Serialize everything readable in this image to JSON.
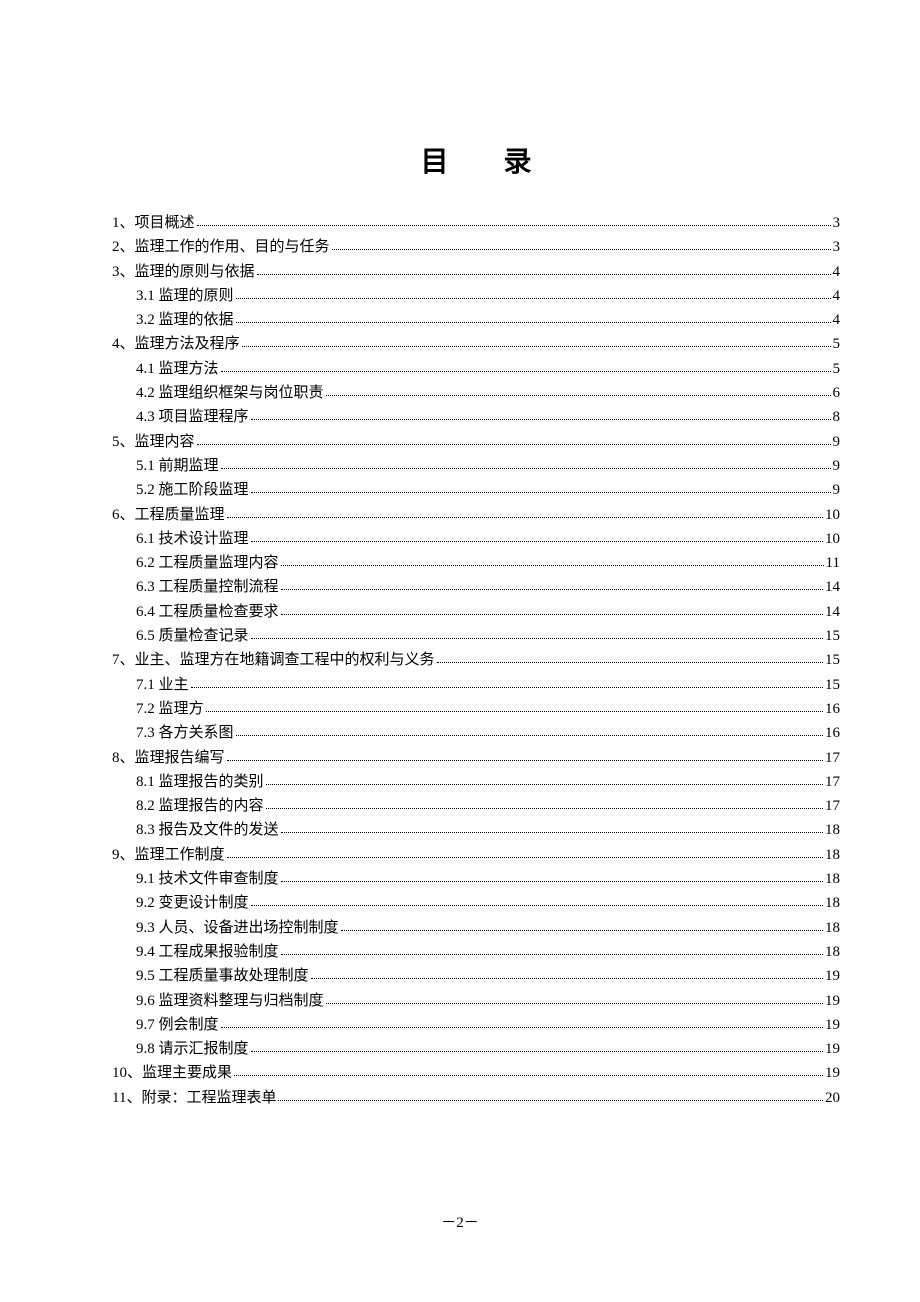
{
  "title": "目 录",
  "page_number": "－2－",
  "toc": [
    {
      "level": 1,
      "label": "1、项目概述",
      "page": "3"
    },
    {
      "level": 1,
      "label": "2、监理工作的作用、目的与任务",
      "page": "3"
    },
    {
      "level": 1,
      "label": "3、监理的原则与依据",
      "page": "4"
    },
    {
      "level": 2,
      "label": "3.1 监理的原则 ",
      "page": "4"
    },
    {
      "level": 2,
      "label": "3.2 监理的依据 ",
      "page": "4"
    },
    {
      "level": 1,
      "label": "4、监理方法及程序",
      "page": "5"
    },
    {
      "level": 2,
      "label": "4.1 监理方法 ",
      "page": "5"
    },
    {
      "level": 2,
      "label": "4.2 监理组织框架与岗位职责 ",
      "page": "6"
    },
    {
      "level": 2,
      "label": "4.3 项目监理程序 ",
      "page": "8"
    },
    {
      "level": 1,
      "label": "5、监理内容",
      "page": "9"
    },
    {
      "level": 2,
      "label": "5.1 前期监理 ",
      "page": "9"
    },
    {
      "level": 2,
      "label": "5.2 施工阶段监理 ",
      "page": "9"
    },
    {
      "level": 1,
      "label": "6、工程质量监理",
      "page": "10"
    },
    {
      "level": 2,
      "label": "6.1  技术设计监理 ",
      "page": "10"
    },
    {
      "level": 2,
      "label": "6.2 工程质量监理内容 ",
      "page": "11"
    },
    {
      "level": 2,
      "label": "6.3 工程质量控制流程 ",
      "page": "14"
    },
    {
      "level": 2,
      "label": "6.4 工程质量检查要求 ",
      "page": "14"
    },
    {
      "level": 2,
      "label": "6.5 质量检查记录 ",
      "page": "15"
    },
    {
      "level": 1,
      "label": "7、业主、监理方在地籍调查工程中的权利与义务",
      "page": "15"
    },
    {
      "level": 2,
      "label": "7.1 业主 ",
      "page": "15"
    },
    {
      "level": 2,
      "label": "7.2 监理方 ",
      "page": "16"
    },
    {
      "level": 2,
      "label": "7.3 各方关系图 ",
      "page": "16"
    },
    {
      "level": 1,
      "label": "8、监理报告编写",
      "page": "17"
    },
    {
      "level": 2,
      "label": "8.1 监理报告的类别 ",
      "page": "17"
    },
    {
      "level": 2,
      "label": "8.2 监理报告的内容 ",
      "page": "17"
    },
    {
      "level": 2,
      "label": "8.3 报告及文件的发送 ",
      "page": "18"
    },
    {
      "level": 1,
      "label": "9、监理工作制度",
      "page": "18"
    },
    {
      "level": 2,
      "label": "9.1  技术文件审查制度 ",
      "page": "18"
    },
    {
      "level": 2,
      "label": "9.2  变更设计制度 ",
      "page": "18"
    },
    {
      "level": 2,
      "label": "9.3  人员、设备进出场控制制度 ",
      "page": "18"
    },
    {
      "level": 2,
      "label": "9.4  工程成果报验制度 ",
      "page": "18"
    },
    {
      "level": 2,
      "label": "9.5  工程质量事故处理制度 ",
      "page": "19"
    },
    {
      "level": 2,
      "label": "9.6  监理资料整理与归档制度 ",
      "page": "19"
    },
    {
      "level": 2,
      "label": "9.7  例会制度 ",
      "page": "19"
    },
    {
      "level": 2,
      "label": "9.8  请示汇报制度 ",
      "page": "19"
    },
    {
      "level": 1,
      "label": "10、监理主要成果",
      "page": "19"
    },
    {
      "level": 1,
      "label": "11、附录：工程监理表单",
      "page": "20"
    }
  ]
}
